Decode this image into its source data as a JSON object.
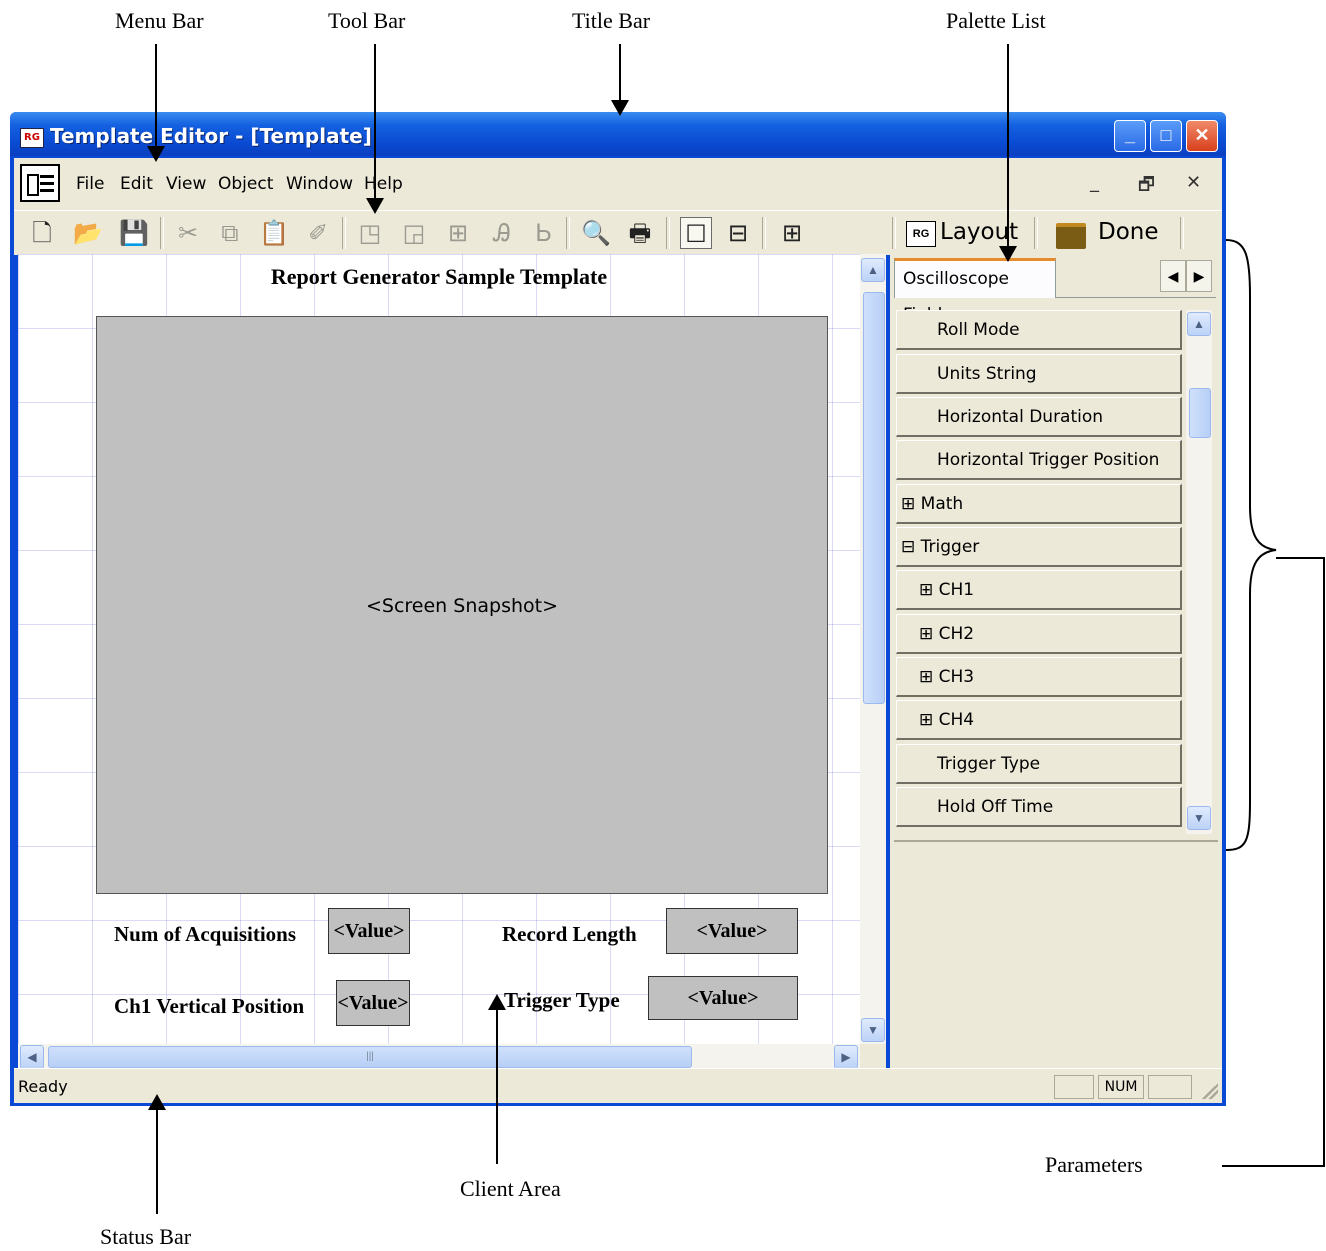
{
  "callouts": {
    "menu_bar": "Menu Bar",
    "tool_bar": "Tool Bar",
    "title_bar": "Title Bar",
    "palette_list": "Palette List",
    "parameters": "Parameters",
    "client_area": "Client Area",
    "status_bar": "Status Bar"
  },
  "window": {
    "app_icon": "RG",
    "title": "Template Editor - [Template]",
    "controls": {
      "minimize": "_",
      "maximize": "□",
      "close": "✕"
    }
  },
  "menu": {
    "items": [
      "File",
      "Edit",
      "View",
      "Object",
      "Window",
      "Help"
    ],
    "mdi_controls": {
      "minimize": "_",
      "restore": "🗗",
      "close": "✕"
    }
  },
  "toolbar": {
    "buttons": [
      {
        "name": "new-icon",
        "glyph": "🗋",
        "enabled": true
      },
      {
        "name": "open-icon",
        "glyph": "📂",
        "enabled": true
      },
      {
        "name": "save-icon",
        "glyph": "💾",
        "enabled": true
      },
      {
        "name": "cut-icon",
        "glyph": "✂",
        "enabled": false
      },
      {
        "name": "copy-icon",
        "glyph": "⧉",
        "enabled": false
      },
      {
        "name": "paste-icon",
        "glyph": "📋",
        "enabled": false
      },
      {
        "name": "eraser-icon",
        "glyph": "✐",
        "enabled": false
      },
      {
        "name": "bring-front-icon",
        "glyph": "◳",
        "enabled": false
      },
      {
        "name": "send-back-icon",
        "glyph": "◲",
        "enabled": false
      },
      {
        "name": "group-icon",
        "glyph": "⊞",
        "enabled": false
      },
      {
        "name": "font-size-up-icon",
        "glyph": "Ꭿ",
        "enabled": false
      },
      {
        "name": "font-size-down-icon",
        "glyph": "Ꮟ",
        "enabled": false
      },
      {
        "name": "print-preview-icon",
        "glyph": "🔍",
        "enabled": true
      },
      {
        "name": "print-icon",
        "glyph": "🖶",
        "enabled": true
      },
      {
        "name": "layout-single-icon",
        "glyph": "☐",
        "enabled": true
      },
      {
        "name": "layout-split-icon",
        "glyph": "⊟",
        "enabled": true
      },
      {
        "name": "layout-quad-icon",
        "glyph": "⊞",
        "enabled": true
      }
    ]
  },
  "palette_tools": {
    "layout_icon": "RG",
    "layout_label": "Layout",
    "done_label": "Done"
  },
  "client": {
    "report_title": "Report Generator Sample Template",
    "snapshot_label": "<Screen Snapshot>",
    "fields": {
      "num_acquisitions_label": "Num of Acquisitions",
      "num_acquisitions_value": "<Value>",
      "record_length_label": "Record Length",
      "record_length_value": "<Value>",
      "ch1_vpos_label": "Ch1 Vertical Position",
      "ch1_vpos_value": "<Value>",
      "trigger_type_label": "Trigger Type",
      "trigger_type_value": "<Value>"
    }
  },
  "palette": {
    "tab_label": "Oscilloscope Fields",
    "items": [
      {
        "label": "Roll Mode",
        "prefix": ""
      },
      {
        "label": "Units String",
        "prefix": ""
      },
      {
        "label": "Horizontal Duration",
        "prefix": ""
      },
      {
        "label": "Horizontal Trigger Position",
        "prefix": ""
      },
      {
        "label": "Math",
        "prefix": "⊞"
      },
      {
        "label": "Trigger",
        "prefix": "⊟"
      },
      {
        "label": "CH1",
        "prefix": "⊞"
      },
      {
        "label": "CH2",
        "prefix": "⊞"
      },
      {
        "label": "CH3",
        "prefix": "⊞"
      },
      {
        "label": "CH4",
        "prefix": "⊞"
      },
      {
        "label": "Trigger Type",
        "prefix": ""
      },
      {
        "label": "Hold Off Time",
        "prefix": ""
      }
    ]
  },
  "status": {
    "text": "Ready",
    "num": "NUM"
  }
}
